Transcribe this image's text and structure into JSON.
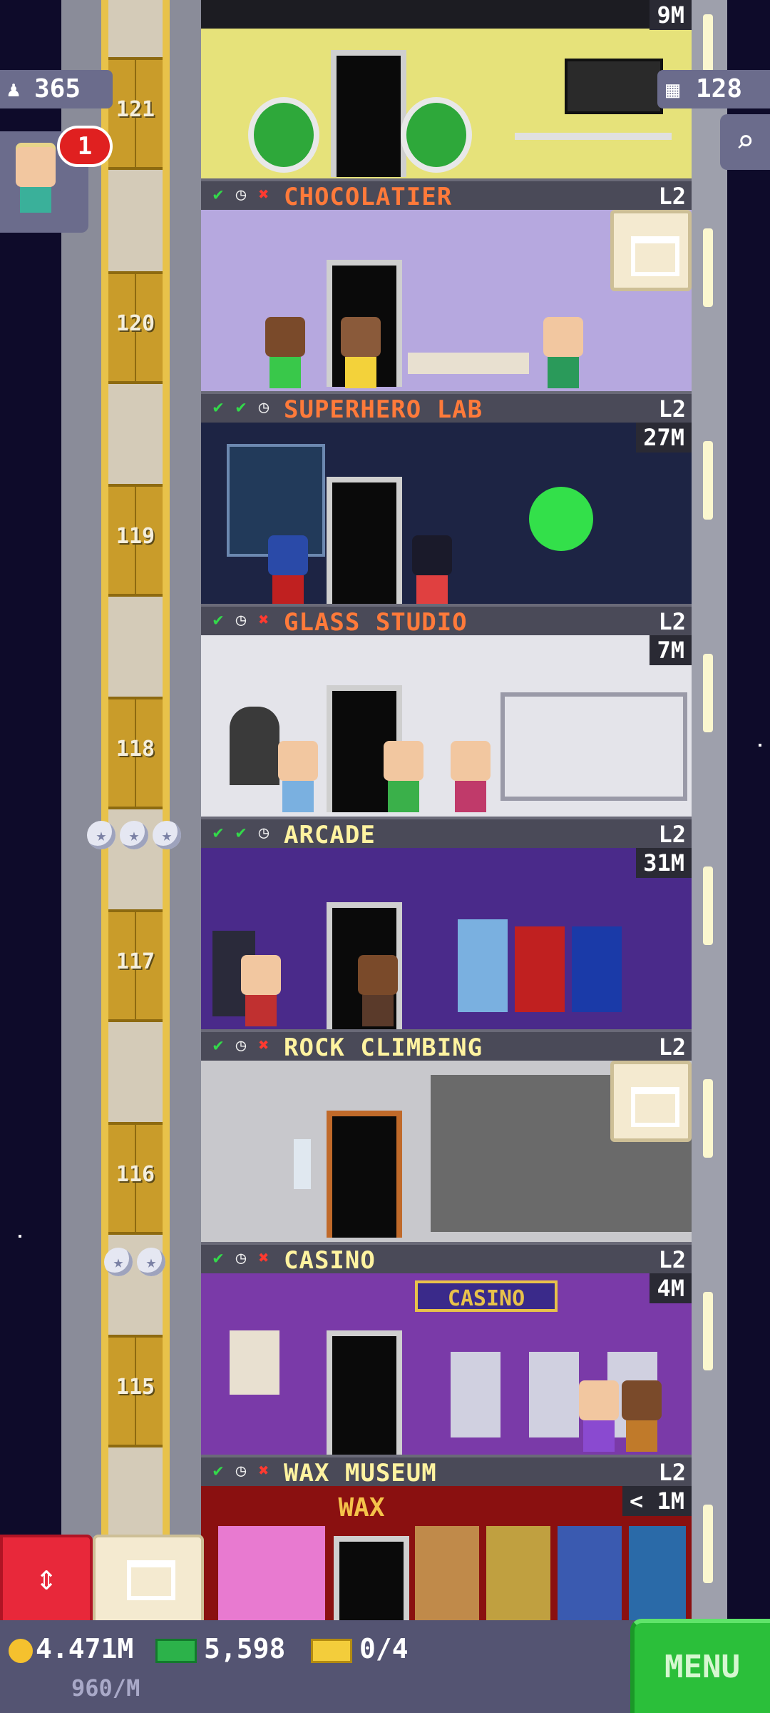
{
  "hud": {
    "population": "365",
    "floor_count": "128",
    "notification_count": "1"
  },
  "shaft": {
    "floor_numbers": [
      "121",
      "120",
      "119",
      "118",
      "117",
      "116",
      "115"
    ]
  },
  "top_floor": {
    "timer": "9M"
  },
  "floors": [
    {
      "name": "CHOCOLATIER",
      "level": "L2",
      "timer": "",
      "status": [
        "check",
        "clock",
        "x"
      ],
      "name_color": "#ff7a3a",
      "stars": 0
    },
    {
      "name": "SUPERHERO LAB",
      "level": "L2",
      "timer": "27M",
      "status": [
        "check",
        "check",
        "clock"
      ],
      "name_color": "#ff7a3a",
      "stars": 0
    },
    {
      "name": "GLASS STUDIO",
      "level": "L2",
      "timer": "7M",
      "status": [
        "check",
        "clock",
        "x"
      ],
      "name_color": "#ff7a3a",
      "stars": 0
    },
    {
      "name": "ARCADE",
      "level": "L2",
      "timer": "31M",
      "status": [
        "check",
        "check",
        "clock"
      ],
      "name_color": "#fff3a0",
      "stars": 3
    },
    {
      "name": "ROCK CLIMBING",
      "level": "L2",
      "timer": "",
      "status": [
        "check",
        "clock",
        "x"
      ],
      "name_color": "#fff3a0",
      "stars": 0
    },
    {
      "name": "CASINO",
      "level": "L2",
      "timer": "4M",
      "status": [
        "check",
        "clock",
        "x"
      ],
      "name_color": "#fff3a0",
      "stars": 2
    },
    {
      "name": "WAX MUSEUM",
      "level": "L2",
      "timer": "< 1M",
      "status": [
        "check",
        "clock",
        "x"
      ],
      "name_color": "#fff3a0",
      "stars": 0
    }
  ],
  "signs": {
    "casino": "CASINO",
    "wax": "WAX"
  },
  "bottom": {
    "coins": "4.471M",
    "bux": "5,598",
    "tickets": "0/4",
    "rate": "960/M",
    "menu_label": "MENU"
  },
  "icons": {
    "population": "person-icon",
    "floors": "building-icon",
    "search": "magnifier-icon",
    "elevator": "up-down-arrows-icon",
    "build": "crate-icon"
  }
}
